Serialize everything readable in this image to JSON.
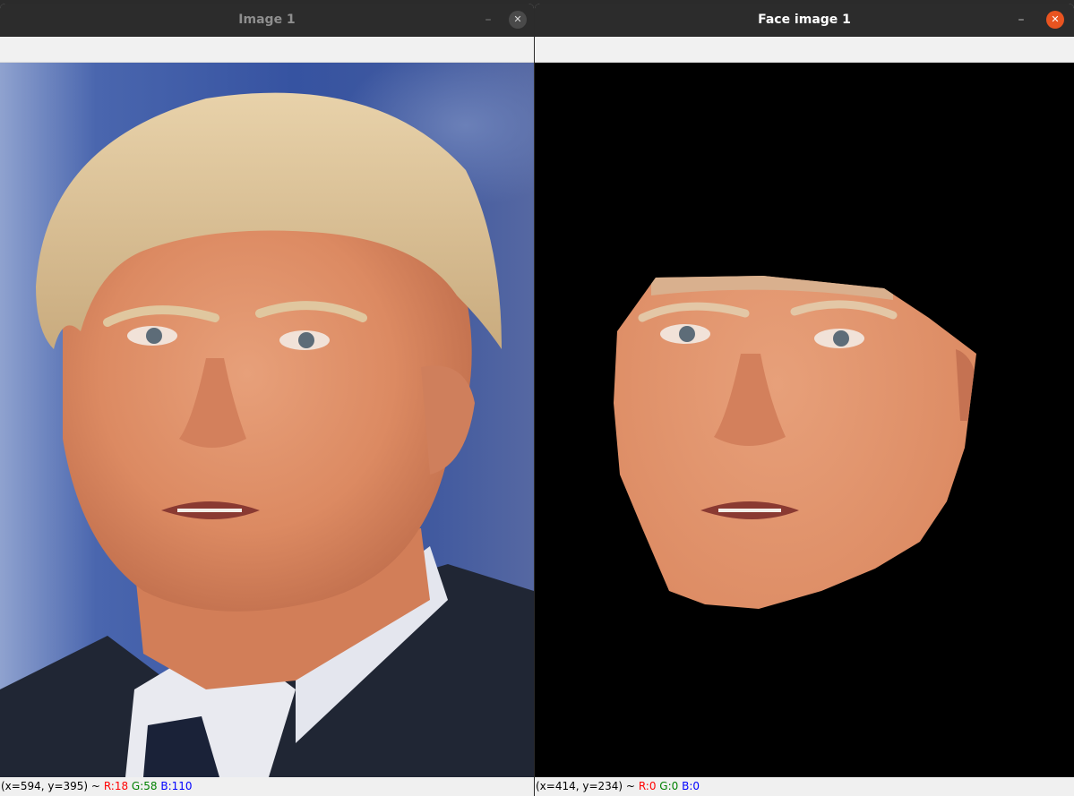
{
  "windows": [
    {
      "title": "Image 1",
      "status": {
        "coords": "(x=594, y=395) ~",
        "r": "R:18",
        "g": "G:58",
        "b": "B:110"
      }
    },
    {
      "title": "Face image 1",
      "status": {
        "coords": "(x=414, y=234) ~",
        "r": "R:0",
        "g": "G:0",
        "b": "B:0"
      }
    }
  ],
  "controls": {
    "minimize": "–",
    "close": "✕"
  },
  "colors": {
    "close_active": "#e95420",
    "titlebar": "#2c2c2c",
    "face_background": "#000000"
  }
}
